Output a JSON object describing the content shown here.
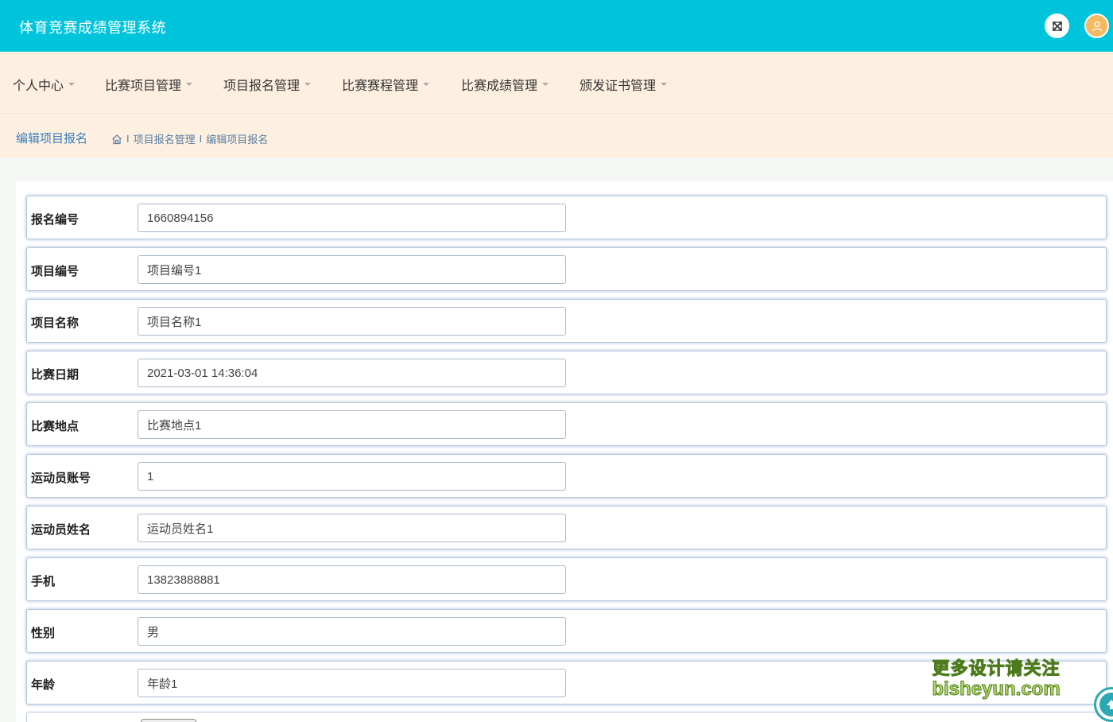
{
  "header": {
    "title": "体育竞赛成绩管理系统",
    "fullscreen_icon": "expand-arrows-icon",
    "avatar_icon": "user-icon",
    "accent_color": "#00c4dc"
  },
  "nav": {
    "items": [
      {
        "label": "个人中心"
      },
      {
        "label": "比赛项目管理"
      },
      {
        "label": "项目报名管理"
      },
      {
        "label": "比赛赛程管理"
      },
      {
        "label": "比赛成绩管理"
      },
      {
        "label": "颁发证书管理"
      }
    ]
  },
  "breadcrumb": {
    "page_title": "编辑项目报名",
    "separator": "I",
    "home_icon": "home-icon",
    "items": [
      "项目报名管理",
      "编辑项目报名"
    ]
  },
  "form": {
    "fields": [
      {
        "label": "报名编号",
        "value": "1660894156"
      },
      {
        "label": "项目编号",
        "value": "项目编号1"
      },
      {
        "label": "项目名称",
        "value": "项目名称1"
      },
      {
        "label": "比赛日期",
        "value": "2021-03-01 14:36:04"
      },
      {
        "label": "比赛地点",
        "value": "比赛地点1"
      },
      {
        "label": "运动员账号",
        "value": "1"
      },
      {
        "label": "运动员姓名",
        "value": "运动员姓名1"
      },
      {
        "label": "手机",
        "value": "13823888881"
      },
      {
        "label": "性别",
        "value": "男"
      },
      {
        "label": "年龄",
        "value": "年龄1"
      }
    ]
  },
  "watermark": {
    "line1": "更多设计请关注",
    "line2": "bisheyun.com"
  },
  "scroll_top_icon": "arrow-up-icon"
}
